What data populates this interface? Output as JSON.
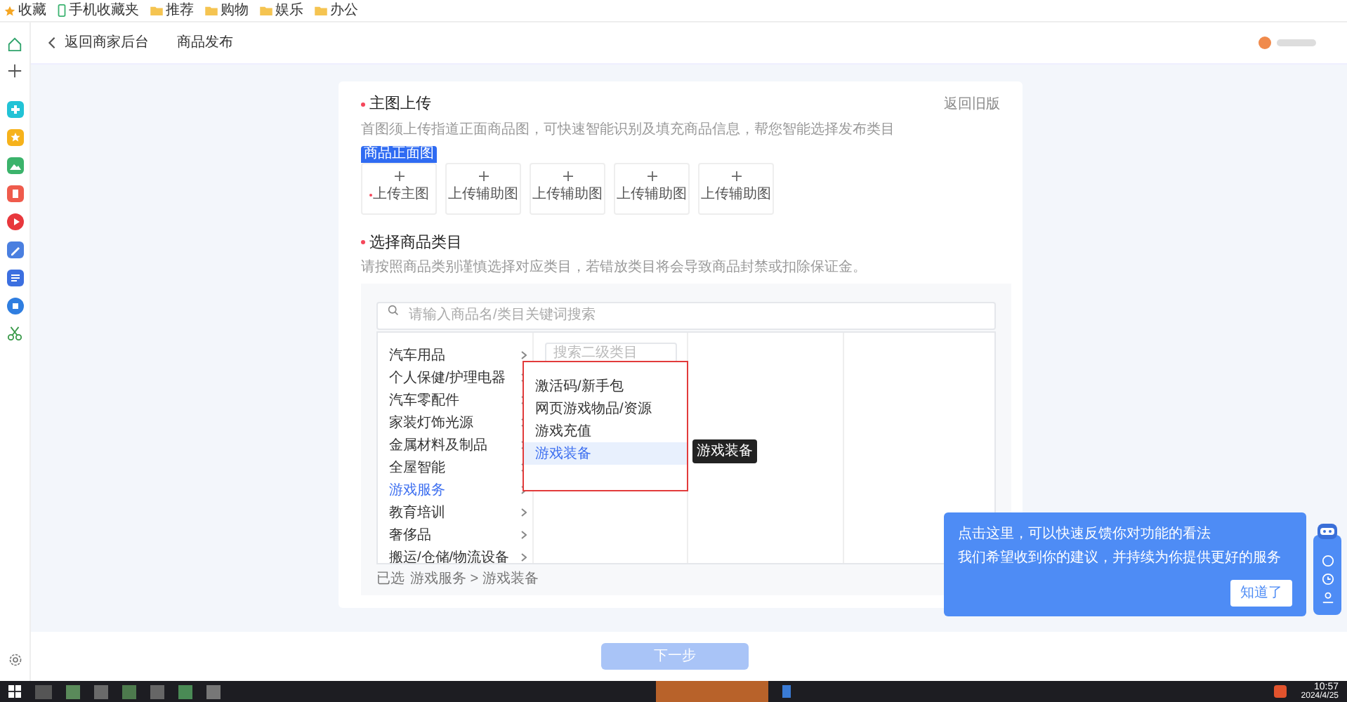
{
  "bookmarks_bar": {
    "items": [
      {
        "label": "收藏",
        "kind": "star"
      },
      {
        "label": "手机收藏夹",
        "kind": "phone"
      },
      {
        "label": "推荐",
        "kind": "folder"
      },
      {
        "label": "购物",
        "kind": "folder"
      },
      {
        "label": "娱乐",
        "kind": "folder"
      },
      {
        "label": "办公",
        "kind": "folder"
      }
    ]
  },
  "header": {
    "back_link": "返回商家后台",
    "title": "商品发布"
  },
  "main_image_upload": {
    "title": "主图上传",
    "required": true,
    "switch_link": "返回旧版",
    "description": "首图须上传指道正面商品图，可快速智能识别及填充商品信息，帮您智能选择发布类目",
    "slots": [
      {
        "badge": "商品正面图",
        "label": "上传主图",
        "required": true
      },
      {
        "label": "上传辅助图",
        "required": false
      },
      {
        "label": "上传辅助图",
        "required": false
      },
      {
        "label": "上传辅助图",
        "required": false
      },
      {
        "label": "上传辅助图",
        "required": false
      }
    ]
  },
  "category": {
    "title": "选择商品类目",
    "required": true,
    "description": "请按照商品类别谨慎选择对应类目，若错放类目将会导致商品封禁或扣除保证金。",
    "search": {
      "placeholder": "请输入商品名/类目关键词搜索"
    },
    "level1": [
      {
        "label": "汽车用品",
        "selected": false
      },
      {
        "label": "个人保健/护理电器",
        "selected": false
      },
      {
        "label": "汽车零配件",
        "selected": false
      },
      {
        "label": "家装灯饰光源",
        "selected": false
      },
      {
        "label": "金属材料及制品",
        "selected": false
      },
      {
        "label": "全屋智能",
        "selected": false
      },
      {
        "label": "游戏服务",
        "selected": true
      },
      {
        "label": "教育培训",
        "selected": false
      },
      {
        "label": "奢侈品",
        "selected": false
      },
      {
        "label": "搬运/仓储/物流设备",
        "selected": false
      }
    ],
    "level2": {
      "search": {
        "placeholder": "搜索二级类目"
      },
      "items": [
        {
          "label": "激活码/新手包",
          "selected": false
        },
        {
          "label": "网页游戏物品/资源",
          "selected": false
        },
        {
          "label": "游戏充值",
          "selected": false
        },
        {
          "label": "游戏装备",
          "selected": true
        }
      ]
    },
    "tooltip": "游戏装备",
    "selected_path": {
      "prefix": "已选",
      "path": "游戏服务 > 游戏装备"
    }
  },
  "footer": {
    "next_button": {
      "label": "下一步",
      "disabled": true
    }
  },
  "feedback_popup": {
    "title": "点击这里，可以快速反馈你对功能的看法",
    "message": "我们希望收到你的建议，并持续为你提供更好的服务",
    "button": "知道了"
  },
  "taskbar": {
    "time": "10:57",
    "date": "2024/4/25"
  }
}
